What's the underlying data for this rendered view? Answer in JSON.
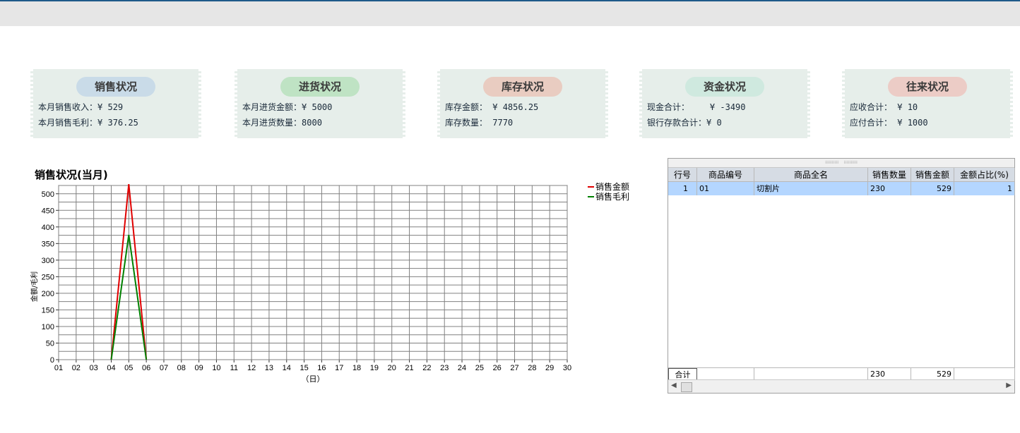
{
  "cards": [
    {
      "title": "销售状况",
      "pill_color": "#c9dbe8",
      "lines": [
        {
          "label": "本月销售收入：",
          "value": "¥ 529"
        },
        {
          "label": "本月销售毛利：",
          "value": "¥ 376.25"
        }
      ]
    },
    {
      "title": "进货状况",
      "pill_color": "#bfe3c4",
      "lines": [
        {
          "label": "本月进货金额：",
          "value": "¥ 5000"
        },
        {
          "label": "本月进货数量：",
          "value": "8000"
        }
      ]
    },
    {
      "title": "库存状况",
      "pill_color": "#e9ccc1",
      "lines": [
        {
          "label": "库存金额：",
          "value": " ¥ 4856.25"
        },
        {
          "label": "库存数量：",
          "value": " 7770"
        }
      ]
    },
    {
      "title": "资金状况",
      "pill_color": "#cfe9df",
      "lines": [
        {
          "label": "现金合计：",
          "value": "    ¥ -3490"
        },
        {
          "label": "银行存款合计：",
          "value": "¥ 0"
        }
      ]
    },
    {
      "title": "往来状况",
      "pill_color": "#ecccc6",
      "lines": [
        {
          "label": "应收合计：",
          "value": " ¥ 10"
        },
        {
          "label": "应付合计：",
          "value": " ¥ 1000"
        }
      ]
    }
  ],
  "chart_data": {
    "type": "line",
    "title": "销售状况(当月)",
    "xlabel": "（日）",
    "ylabel": "金额/毛利",
    "x": [
      "01",
      "02",
      "03",
      "04",
      "05",
      "06",
      "07",
      "08",
      "09",
      "10",
      "11",
      "12",
      "13",
      "14",
      "15",
      "16",
      "17",
      "18",
      "19",
      "20",
      "21",
      "22",
      "23",
      "24",
      "25",
      "26",
      "27",
      "28",
      "29",
      "30"
    ],
    "ylim": [
      0,
      525
    ],
    "yticks": [
      0,
      50,
      100,
      150,
      200,
      250,
      300,
      350,
      400,
      450,
      500
    ],
    "grid": true,
    "legend": "right",
    "series": [
      {
        "name": "销售金额",
        "color": "#e00000",
        "points": [
          [
            "04",
            0
          ],
          [
            "05",
            529
          ],
          [
            "06",
            0
          ]
        ]
      },
      {
        "name": "销售毛利",
        "color": "#008000",
        "points": [
          [
            "04",
            0
          ],
          [
            "05",
            376.25
          ],
          [
            "06",
            0
          ]
        ]
      }
    ]
  },
  "grid": {
    "columns": [
      "行号",
      "商品编号",
      "商品全名",
      "销售数量",
      "销售金额",
      "金额占比(%)"
    ],
    "rows": [
      [
        "1",
        "01",
        "切割片",
        "230",
        "529",
        "1"
      ]
    ],
    "footer": [
      "合计",
      "",
      "",
      "230",
      "529",
      ""
    ]
  }
}
